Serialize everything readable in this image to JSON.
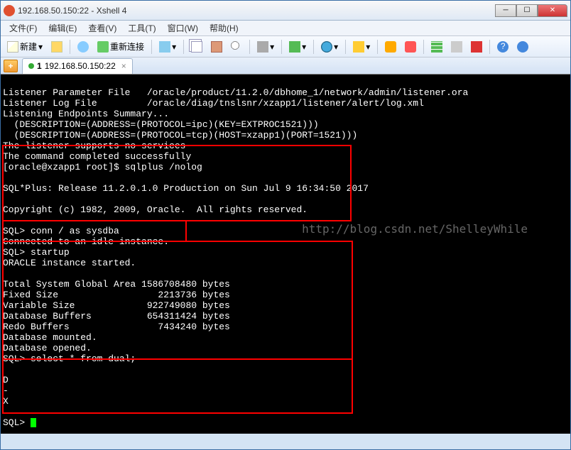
{
  "window": {
    "title": "192.168.50.150:22 - Xshell 4"
  },
  "menu": {
    "file": "文件(F)",
    "edit": "编辑(E)",
    "view": "查看(V)",
    "tools": "工具(T)",
    "window": "窗口(W)",
    "help": "帮助(H)"
  },
  "toolbar": {
    "new": "新建",
    "reconnect": "重新连接"
  },
  "tab": {
    "prefix": "1",
    "label": "192.168.50.150:22"
  },
  "watermark": "http://blog.csdn.net/ShelleyWhile",
  "term": {
    "l1": "Listener Parameter File   /oracle/product/11.2.0/dbhome_1/network/admin/listener.ora",
    "l2": "Listener Log File         /oracle/diag/tnslsnr/xzapp1/listener/alert/log.xml",
    "l3": "Listening Endpoints Summary...",
    "l4": "  (DESCRIPTION=(ADDRESS=(PROTOCOL=ipc)(KEY=EXTPROC1521)))",
    "l5": "  (DESCRIPTION=(ADDRESS=(PROTOCOL=tcp)(HOST=xzapp1)(PORT=1521)))",
    "l6": "The listener supports no services",
    "l7": "The command completed successfully",
    "l8": "[oracle@xzapp1 root]$ sqlplus /nolog",
    "l9": "",
    "l10": "SQL*Plus: Release 11.2.0.1.0 Production on Sun Jul 9 16:34:50 2017",
    "l11": "",
    "l12": "Copyright (c) 1982, 2009, Oracle.  All rights reserved.",
    "l13": "",
    "l14": "SQL> conn / as sysdba",
    "l15": "Connected to an idle instance.",
    "l16": "SQL> startup",
    "l17": "ORACLE instance started.",
    "l18": "",
    "l19": "Total System Global Area 1586708480 bytes",
    "l20": "Fixed Size                  2213736 bytes",
    "l21": "Variable Size             922749080 bytes",
    "l22": "Database Buffers          654311424 bytes",
    "l23": "Redo Buffers                7434240 bytes",
    "l24": "Database mounted.",
    "l25": "Database opened.",
    "l26": "SQL> select * from dual;",
    "l27": "",
    "l28": "D",
    "l29": "-",
    "l30": "X",
    "l31": "",
    "l32": "SQL> "
  }
}
